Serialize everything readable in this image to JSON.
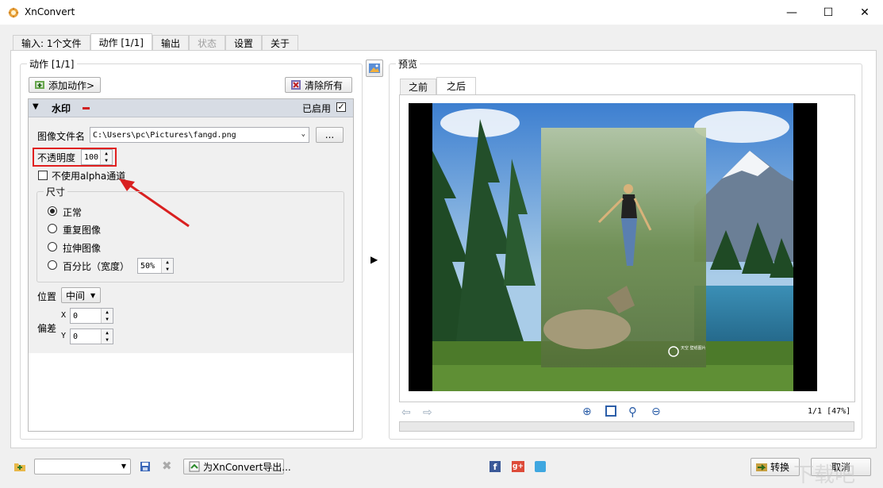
{
  "window": {
    "title": "XnConvert",
    "minimize": "—",
    "maximize": "☐",
    "close": "✕"
  },
  "tabs": [
    {
      "label": "输入: 1个文件"
    },
    {
      "label": "动作 [1/1]"
    },
    {
      "label": "输出"
    },
    {
      "label": "状态"
    },
    {
      "label": "设置"
    },
    {
      "label": "关于"
    }
  ],
  "actions": {
    "group_title": "动作 [1/1]",
    "add_action": "添加动作>",
    "clear_all": "清除所有",
    "watermark": {
      "title": "水印",
      "enabled_label": "已启用",
      "enabled": true,
      "filename_label": "图像文件名",
      "filename_value": "C:\\Users\\pc\\Pictures\\fangd.png",
      "browse_label": "...",
      "opacity_label": "不透明度",
      "opacity_value": "100",
      "no_alpha_label": "不使用alpha通道",
      "size_title": "尺寸",
      "size_options": [
        "正常",
        "重复图像",
        "拉伸图像",
        "百分比（宽度）"
      ],
      "size_selected": "正常",
      "percent_value": "50%",
      "position_label": "位置",
      "position_value": "中间",
      "offset_label": "偏差",
      "x_label": "X",
      "x_value": "0",
      "y_label": "Y",
      "y_value": "0"
    }
  },
  "preview": {
    "group_title": "预览",
    "tabs": [
      "之前",
      "之后"
    ],
    "active_tab": "之后",
    "page_info": "1/1 [47%]",
    "watermark_text": "天空 壁纸图片"
  },
  "footer": {
    "export_label": "为XnConvert导出...",
    "convert_label": "转换",
    "cancel_label": "取消",
    "site_watermark": "下载吧"
  },
  "colors": {
    "highlight": "#e02020",
    "arrow": "#d92020",
    "header": "#d7dce4"
  }
}
